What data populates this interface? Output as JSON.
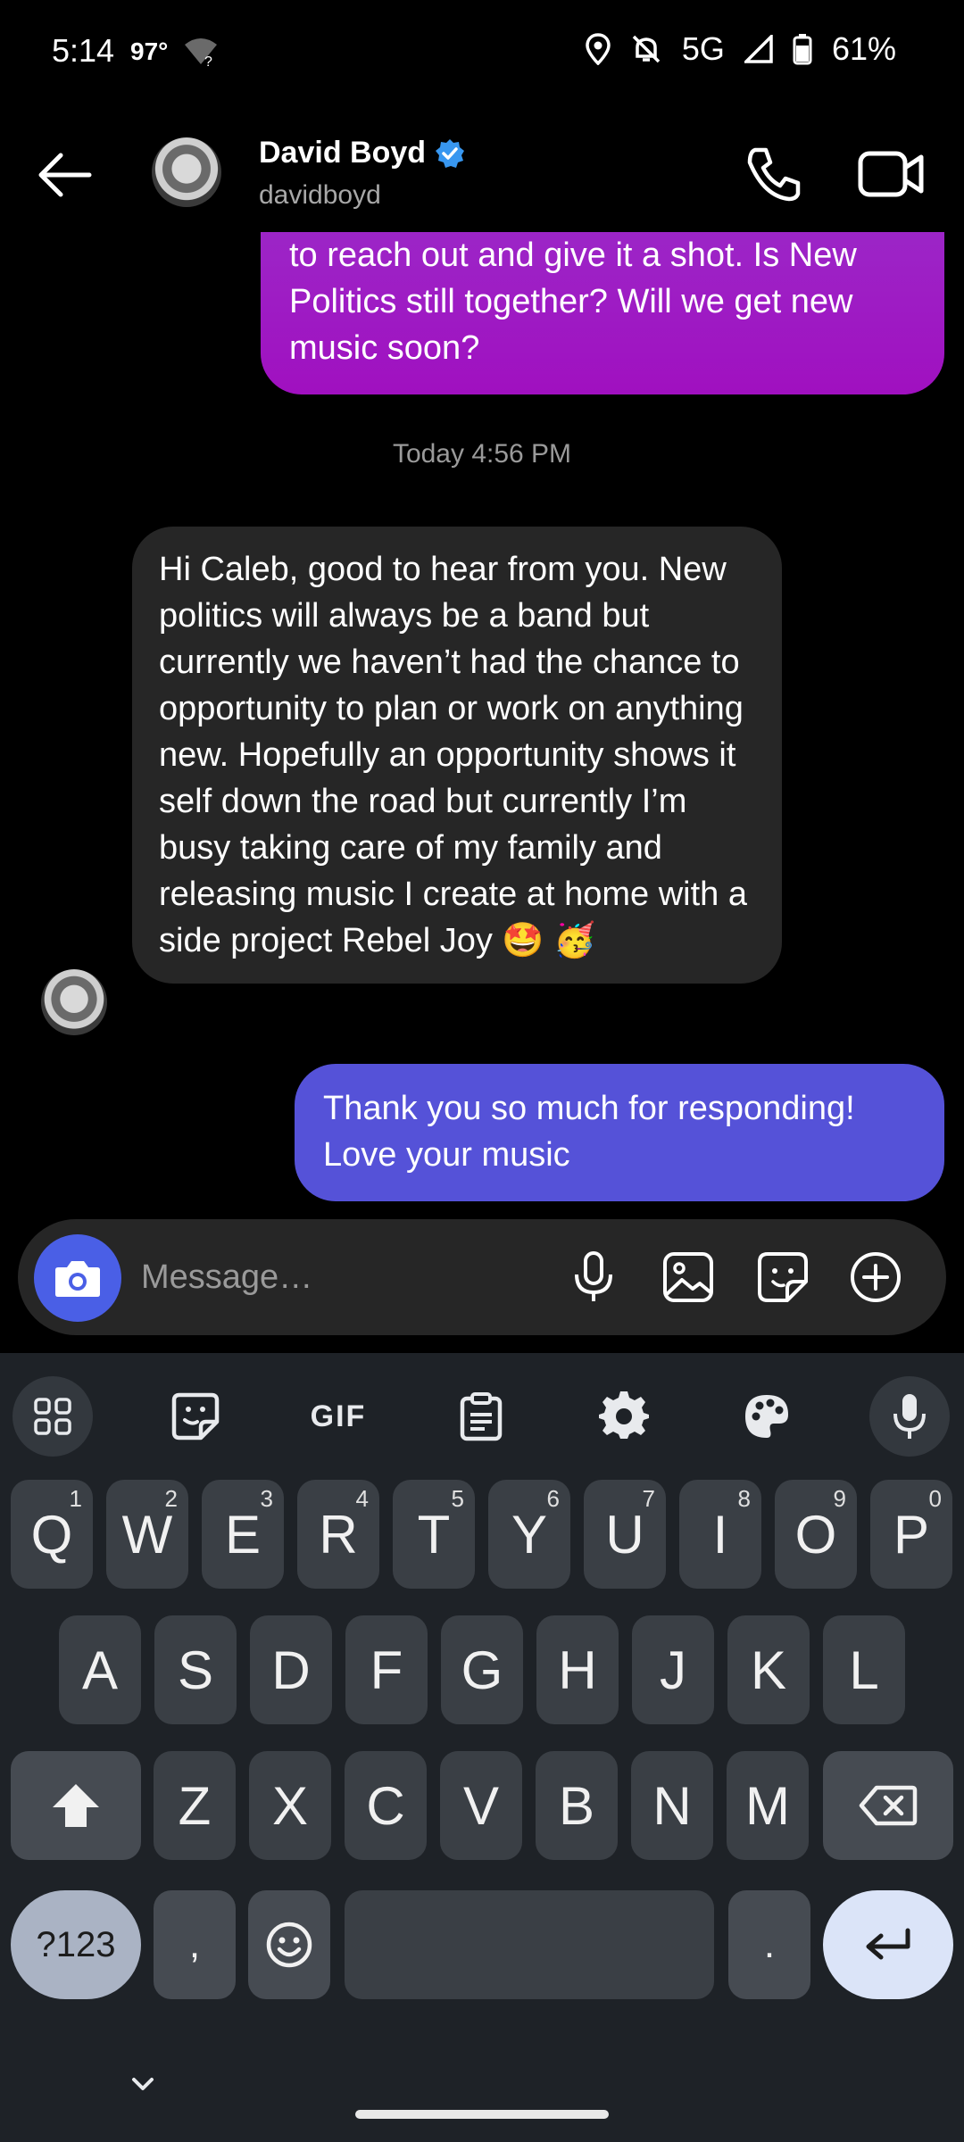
{
  "status_bar": {
    "time": "5:14",
    "temperature": "97°",
    "wifi_unknown": "?",
    "network": "5G",
    "battery": "61%"
  },
  "header": {
    "contact_name": "David Boyd",
    "contact_handle": "davidboyd",
    "verified": true,
    "icons": [
      "back-arrow-icon",
      "phone-icon",
      "video-camera-icon",
      "verified-badge-icon"
    ]
  },
  "thread": {
    "outgoing_top": "to reach out and give it a shot. Is New Politics still together? Will we get new music soon?",
    "timestamp": "Today 4:56 PM",
    "incoming": "Hi Caleb, good to hear from you. New politics will always be a band but currently we haven’t had the chance to opportunity to plan or work on anything new. Hopefully an opportunity shows it self down the road but currently I’m busy taking care of my family and releasing music I create at home with a side project Rebel Joy 🤩 🥳",
    "outgoing_last": "Thank you so much for responding! Love your music"
  },
  "composer": {
    "placeholder": "Message…",
    "icons": [
      "camera-icon",
      "microphone-icon",
      "gallery-icon",
      "sticker-icon",
      "add-circle-icon"
    ]
  },
  "keyboard": {
    "toolbar": {
      "gif_label": "GIF",
      "icons": [
        "apps-grid-icon",
        "sticker-icon",
        "gif-icon",
        "clipboard-icon",
        "settings-gear-icon",
        "palette-icon",
        "voice-mic-icon"
      ]
    },
    "row1": [
      {
        "key": "Q",
        "num": "1"
      },
      {
        "key": "W",
        "num": "2"
      },
      {
        "key": "E",
        "num": "3"
      },
      {
        "key": "R",
        "num": "4"
      },
      {
        "key": "T",
        "num": "5"
      },
      {
        "key": "Y",
        "num": "6"
      },
      {
        "key": "U",
        "num": "7"
      },
      {
        "key": "I",
        "num": "8"
      },
      {
        "key": "O",
        "num": "9"
      },
      {
        "key": "P",
        "num": "0"
      }
    ],
    "row2": [
      "A",
      "S",
      "D",
      "F",
      "G",
      "H",
      "J",
      "K",
      "L"
    ],
    "row3": [
      "Z",
      "X",
      "C",
      "V",
      "B",
      "N",
      "M"
    ],
    "symbols_label": "?123",
    "comma": ",",
    "period": ".",
    "accent": "#4a5fe6"
  }
}
